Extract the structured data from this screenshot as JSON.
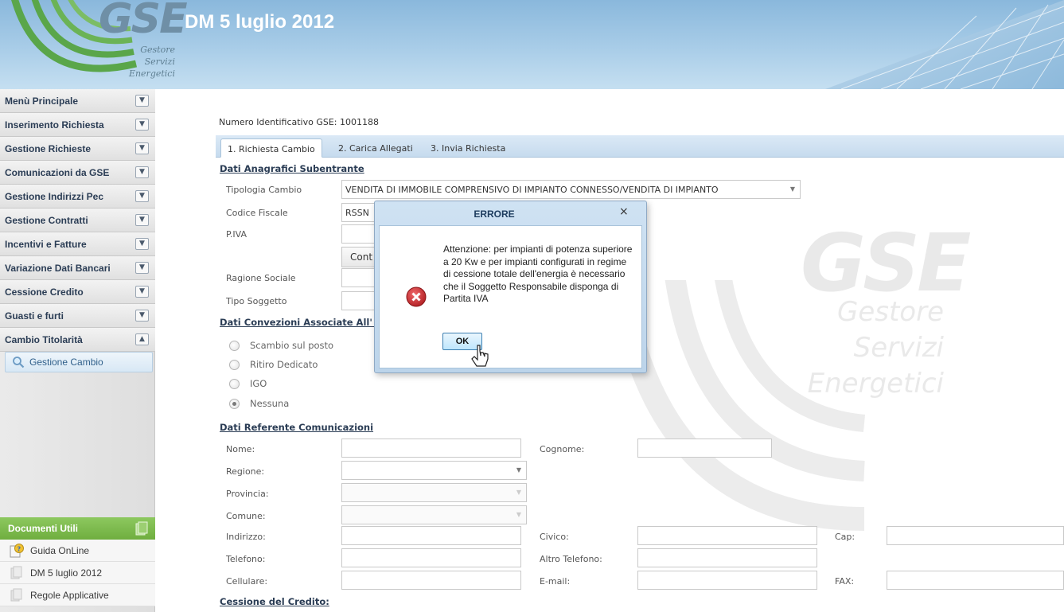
{
  "header": {
    "logo": "GSE",
    "logo_lines": [
      "Gestore",
      "Servizi",
      "Energetici"
    ],
    "title": "DM 5 luglio 2012"
  },
  "sidebar": {
    "items": [
      {
        "label": "Menù Principale",
        "chevron": "▼"
      },
      {
        "label": "Inserimento Richiesta",
        "chevron": "▼"
      },
      {
        "label": "Gestione Richieste",
        "chevron": "▼"
      },
      {
        "label": "Comunicazioni da GSE",
        "chevron": "▼"
      },
      {
        "label": "Gestione Indirizzi Pec",
        "chevron": "▼"
      },
      {
        "label": "Gestione Contratti",
        "chevron": "▼"
      },
      {
        "label": "Incentivi e Fatture",
        "chevron": "▼"
      },
      {
        "label": "Variazione Dati Bancari",
        "chevron": "▼"
      },
      {
        "label": "Cessione Credito",
        "chevron": "▼"
      },
      {
        "label": "Guasti e furti",
        "chevron": "▼"
      },
      {
        "label": "Cambio Titolarità",
        "chevron": "▲"
      }
    ],
    "subitem": "Gestione Cambio",
    "docs_title": "Documenti Utili",
    "docs": [
      "Guida OnLine",
      "DM 5 luglio 2012",
      "Regole Applicative"
    ]
  },
  "main": {
    "id_line": "Numero Identificativo GSE: 1001188",
    "tabs": [
      "1. Richiesta Cambio",
      "2. Carica Allegati",
      "3. Invia Richiesta"
    ],
    "section_anagrafici": "Dati Anagrafici Subentrante",
    "tipologia_label": "Tipologia Cambio",
    "tipologia_value": "VENDITA DI IMMOBILE COMPRENSIVO DI IMPIANTO CONNESSO/VENDITA DI IMPIANTO",
    "cf_label": "Codice Fiscale",
    "cf_value": "RSSN",
    "piva_label": "P.IVA",
    "cont_button": "Cont",
    "ragione_label": "Ragione Sociale",
    "tipo_soggetto_label": "Tipo Soggetto",
    "section_convenzioni": "Dati Convezioni Associate All' in",
    "radios": [
      {
        "label": "Scambio sul posto",
        "checked": false
      },
      {
        "label": "Ritiro Dedicato",
        "checked": false
      },
      {
        "label": "IGO",
        "checked": false
      },
      {
        "label": "Nessuna",
        "checked": true
      }
    ],
    "section_referente": "Dati Referente Comunicazioni",
    "nome_label": "Nome:",
    "cognome_label": "Cognome:",
    "regione_label": "Regione:",
    "provincia_label": "Provincia:",
    "comune_label": "Comune:",
    "indirizzo_label": "Indirizzo:",
    "civico_label": "Civico:",
    "cap_label": "Cap:",
    "telefono_label": "Telefono:",
    "altro_tel_label": "Altro Telefono:",
    "cellulare_label": "Cellulare:",
    "email_label": "E-mail:",
    "fax_label": "FAX:",
    "section_cessione": "Cessione del Credito:",
    "select_arrow": "▼"
  },
  "watermark": {
    "logo": "GSE",
    "lines": [
      "Gestore",
      "Servizi",
      "Energetici"
    ]
  },
  "dialog": {
    "title": "ERRORE",
    "close": "×",
    "message": "Attenzione: per impianti di potenza superiore a 20 Kw e per impianti configurati in regime di cessione totale dell'energia è necessario che il Soggetto Responsabile disponga di Partita IVA",
    "ok_label": "OK"
  },
  "colors": {
    "header_blue": "#a9cde8",
    "menu_text": "#2b3d55",
    "docs_green": "#7ab84a",
    "error_red": "#c8282d"
  }
}
